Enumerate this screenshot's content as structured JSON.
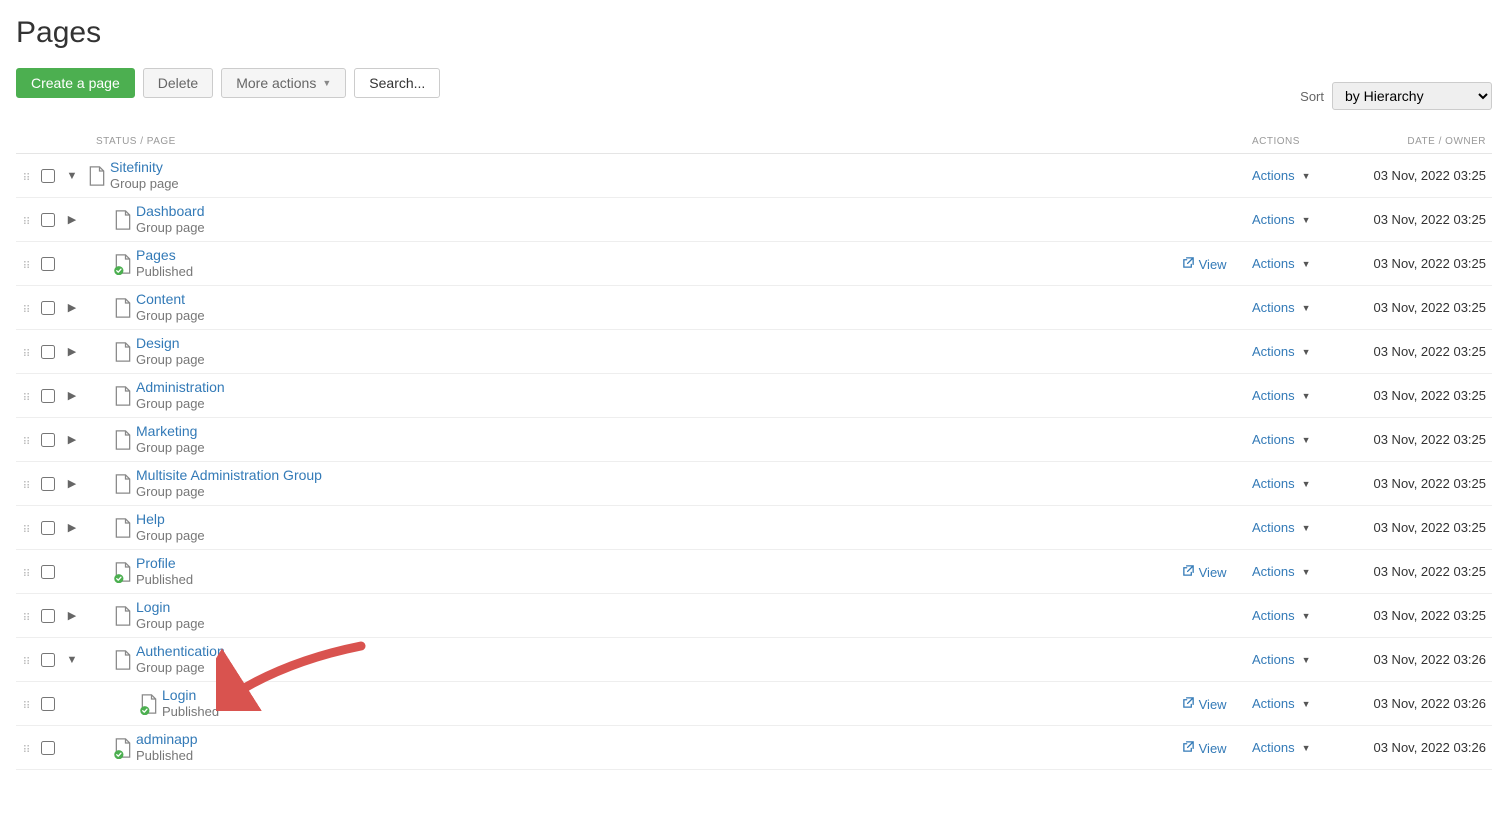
{
  "title": "Pages",
  "toolbar": {
    "create": "Create a page",
    "delete": "Delete",
    "more": "More actions",
    "search": "Search..."
  },
  "sort": {
    "label": "Sort",
    "value": "by Hierarchy"
  },
  "headers": {
    "status": "STATUS / PAGE",
    "actions": "ACTIONS",
    "date": "DATE / OWNER"
  },
  "rowLabels": {
    "actions": "Actions",
    "view": "View"
  },
  "rows": [
    {
      "name": "Sitefinity",
      "sub": "Group page",
      "expand": "down",
      "indent": 0,
      "icon": "group",
      "view": false,
      "date": "03 Nov, 2022 03:25"
    },
    {
      "name": "Dashboard",
      "sub": "Group page",
      "expand": "right",
      "indent": 1,
      "icon": "group",
      "view": false,
      "date": "03 Nov, 2022 03:25"
    },
    {
      "name": "Pages",
      "sub": "Published",
      "expand": "none",
      "indent": 1,
      "icon": "pub",
      "view": true,
      "date": "03 Nov, 2022 03:25"
    },
    {
      "name": "Content",
      "sub": "Group page",
      "expand": "right",
      "indent": 1,
      "icon": "group",
      "view": false,
      "date": "03 Nov, 2022 03:25"
    },
    {
      "name": "Design",
      "sub": "Group page",
      "expand": "right",
      "indent": 1,
      "icon": "group",
      "view": false,
      "date": "03 Nov, 2022 03:25"
    },
    {
      "name": "Administration",
      "sub": "Group page",
      "expand": "right",
      "indent": 1,
      "icon": "group",
      "view": false,
      "date": "03 Nov, 2022 03:25"
    },
    {
      "name": "Marketing",
      "sub": "Group page",
      "expand": "right",
      "indent": 1,
      "icon": "group",
      "view": false,
      "date": "03 Nov, 2022 03:25"
    },
    {
      "name": "Multisite Administration Group",
      "sub": "Group page",
      "expand": "right",
      "indent": 1,
      "icon": "group",
      "view": false,
      "date": "03 Nov, 2022 03:25"
    },
    {
      "name": "Help",
      "sub": "Group page",
      "expand": "right",
      "indent": 1,
      "icon": "group",
      "view": false,
      "date": "03 Nov, 2022 03:25"
    },
    {
      "name": "Profile",
      "sub": "Published",
      "expand": "none",
      "indent": 1,
      "icon": "pub",
      "view": true,
      "date": "03 Nov, 2022 03:25"
    },
    {
      "name": "Login",
      "sub": "Group page",
      "expand": "right",
      "indent": 1,
      "icon": "group",
      "view": false,
      "date": "03 Nov, 2022 03:25"
    },
    {
      "name": "Authentication",
      "sub": "Group page",
      "expand": "down",
      "indent": 1,
      "icon": "group",
      "view": false,
      "date": "03 Nov, 2022 03:26"
    },
    {
      "name": "Login",
      "sub": "Published",
      "expand": "none",
      "indent": 2,
      "icon": "pub",
      "view": true,
      "date": "03 Nov, 2022 03:26"
    },
    {
      "name": "adminapp",
      "sub": "Published",
      "expand": "none",
      "indent": 1,
      "icon": "pub",
      "view": true,
      "date": "03 Nov, 2022 03:26"
    }
  ]
}
